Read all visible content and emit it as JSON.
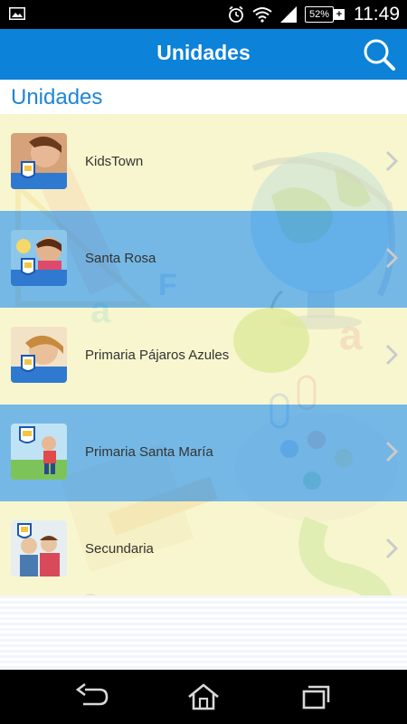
{
  "status_bar": {
    "battery_level": "52%",
    "time": "11:49",
    "icons": [
      "image-icon",
      "alarm-icon",
      "wifi-icon",
      "signal-icon",
      "battery-icon"
    ]
  },
  "app_bar": {
    "title": "Unidades",
    "search_icon": "search-icon"
  },
  "section": {
    "title": "Unidades"
  },
  "units": [
    {
      "label": "KidsTown"
    },
    {
      "label": "Santa Rosa"
    },
    {
      "label": "Primaria Pájaros Azules"
    },
    {
      "label": "Primaria Santa María"
    },
    {
      "label": "Secundaria"
    }
  ],
  "nav_bar": {
    "icons": [
      "back-icon",
      "home-icon",
      "recents-icon"
    ]
  },
  "colors": {
    "app_bar": "#0c82d8",
    "row_highlight": "#42a0ec",
    "row_light": "#f7f5c8",
    "section_title": "#1e86d6"
  }
}
